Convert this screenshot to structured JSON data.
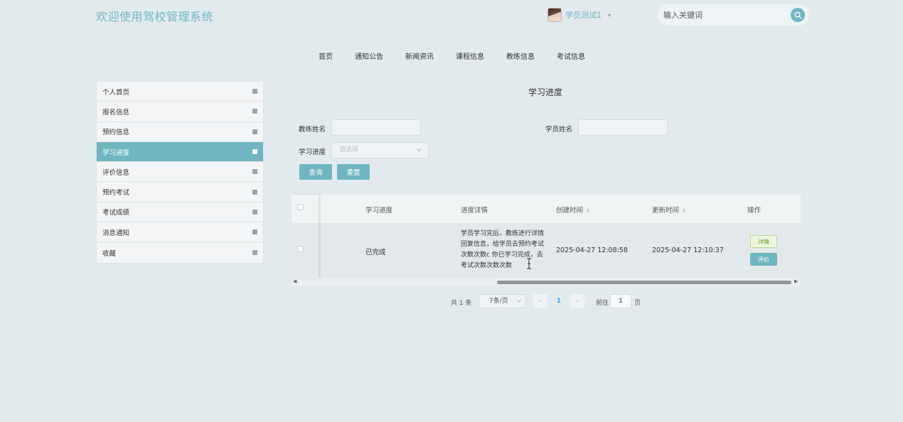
{
  "header": {
    "site_title": "欢迎使用驾校管理系统",
    "user_name": "学员测试1",
    "user_caret": "▾",
    "search_placeholder": "输入关键词"
  },
  "nav": {
    "items": [
      "首页",
      "通知公告",
      "新闻资讯",
      "课程信息",
      "教练信息",
      "考试信息"
    ]
  },
  "sidebar": {
    "items": [
      {
        "label": "个人首页",
        "active": false
      },
      {
        "label": "报名信息",
        "active": false
      },
      {
        "label": "预约信息",
        "active": false
      },
      {
        "label": "学习进度",
        "active": true
      },
      {
        "label": "评价信息",
        "active": false
      },
      {
        "label": "预约考试",
        "active": false
      },
      {
        "label": "考试成绩",
        "active": false
      },
      {
        "label": "消息通知",
        "active": false
      },
      {
        "label": "收藏",
        "active": false
      }
    ]
  },
  "main": {
    "title": "学习进度",
    "filters": {
      "coach_name_label": "教练姓名",
      "student_name_label": "学员姓名",
      "progress_label": "学习进度",
      "progress_placeholder": "请选择",
      "query_button": "查询",
      "reset_button": "重置"
    },
    "table": {
      "headers": {
        "progress": "学习进度",
        "detail": "进度详情",
        "created": "创建时间",
        "updated": "更新时间",
        "actions": "操作"
      },
      "sort_icon": "⇕",
      "rows": [
        {
          "progress": "已完成",
          "detail": "学员学习完后，教练进行详情回复信息，给学员去预约考试次数次数c 你已学习完成，去考试次数次数次数",
          "created": "2025-04-27 12:08:58",
          "updated": "2025-04-27 12:10:37",
          "detail_button": "详情",
          "eval_button": "评价"
        }
      ]
    },
    "pagination": {
      "total": "共 1 条",
      "page_size": "7条/页",
      "prev": "‹",
      "current": "1",
      "next": "›",
      "goto_label": "前往",
      "goto_value": "1",
      "page_suffix": "页"
    }
  },
  "colors": {
    "accent": "#6fb6c1",
    "background": "#e2eaee",
    "link_blue": "#409eff"
  }
}
